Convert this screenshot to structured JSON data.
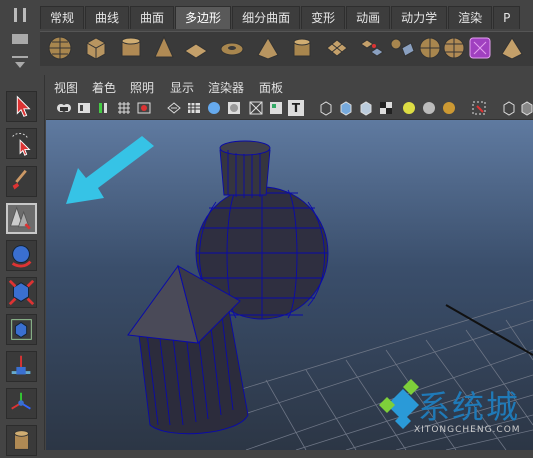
{
  "shelf": {
    "tabs": [
      {
        "label": "常规",
        "active": false
      },
      {
        "label": "曲线",
        "active": false
      },
      {
        "label": "曲面",
        "active": false
      },
      {
        "label": "多边形",
        "active": true
      },
      {
        "label": "细分曲面",
        "active": false
      },
      {
        "label": "变形",
        "active": false
      },
      {
        "label": "动画",
        "active": false
      },
      {
        "label": "动力学",
        "active": false
      },
      {
        "label": "渲染",
        "active": false
      },
      {
        "label": "P",
        "active": false
      }
    ],
    "icons": [
      "poly-sphere-icon",
      "poly-cube-icon",
      "poly-cylinder-icon",
      "poly-cone-icon",
      "poly-plane-icon",
      "poly-torus-icon",
      "poly-pyramid-icon",
      "poly-pipe-icon",
      "poly-helix-icon",
      "combine-icon",
      "separate-icon",
      "extract-icon",
      "smooth-icon",
      "boolean-icon",
      "mirror-icon",
      "bevel-icon",
      "extrude-icon"
    ]
  },
  "panel_menu": {
    "items": [
      "视图",
      "着色",
      "照明",
      "显示",
      "渲染器",
      "面板"
    ]
  },
  "panel_toolbar": {
    "camera_label": "T"
  },
  "colors": {
    "ui_bg": "#444444",
    "viewport_top": "#5f7aa0",
    "viewport_bottom": "#2c3645",
    "arrow": "#36c3e6",
    "watermark": "#1f7ab8"
  },
  "watermark": {
    "title": "系统城",
    "url": "XITONGCHENG.COM"
  }
}
